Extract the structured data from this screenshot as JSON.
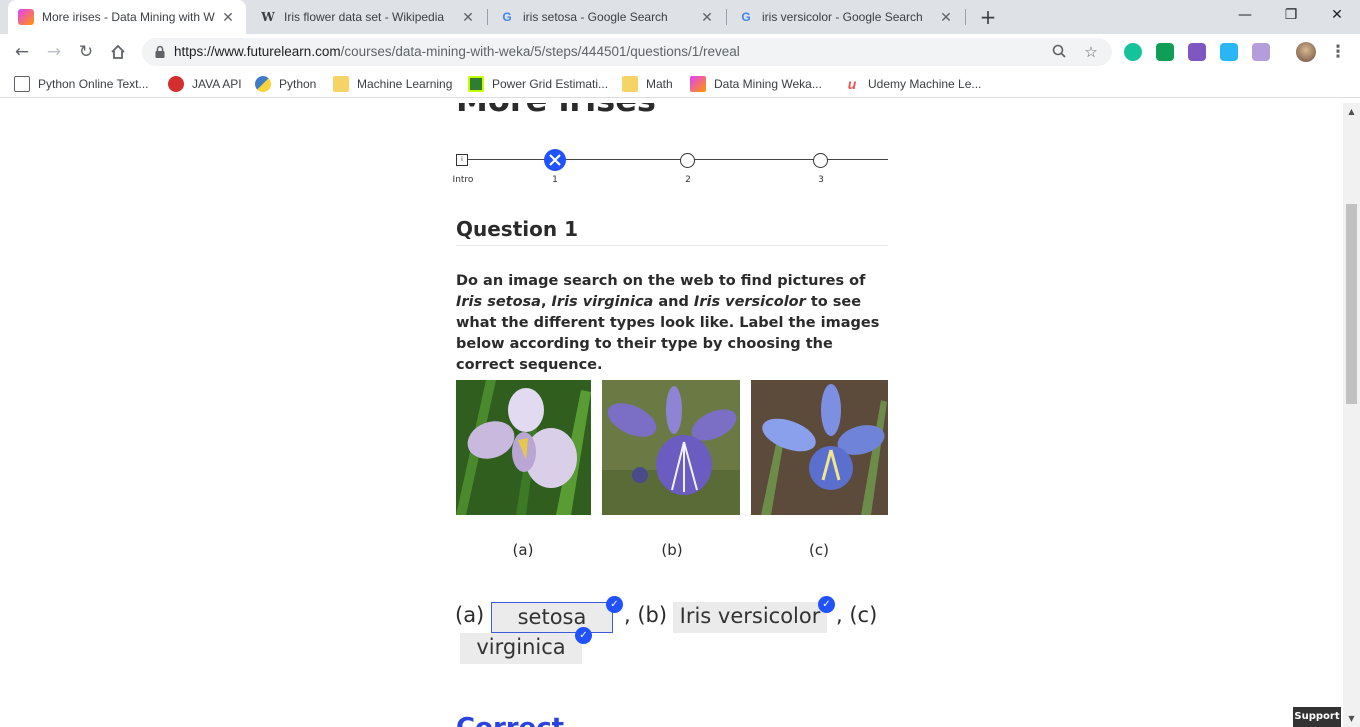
{
  "tabs": [
    {
      "title": "More irises - Data Mining with W",
      "favicon": "futurelearn-icon",
      "active": true
    },
    {
      "title": "Iris flower data set - Wikipedia",
      "favicon": "wikipedia-icon",
      "active": false
    },
    {
      "title": "iris setosa - Google Search",
      "favicon": "google-icon",
      "active": false
    },
    {
      "title": "iris versicolor - Google Search",
      "favicon": "google-icon",
      "active": false
    }
  ],
  "window_controls": {
    "minimize": "—",
    "restore": "❐",
    "close": "✕"
  },
  "address_bar": {
    "host": "https://www.futurelearn.com",
    "path": "/courses/data-mining-with-weka/5/steps/444501/questions/1/reveal"
  },
  "bookmarks": [
    {
      "label": "Python Online Text...",
      "color": "#5f6368"
    },
    {
      "label": "JAVA API",
      "color": "#d32f2f"
    },
    {
      "label": "Python",
      "color": "#3f7cc4"
    },
    {
      "label": "Machine Learning",
      "color": "#f6d365"
    },
    {
      "label": "Power Grid Estimati...",
      "color": "#2e7d32"
    },
    {
      "label": "Math",
      "color": "#f6d365"
    },
    {
      "label": "Data Mining Weka...",
      "color": "#e91e63"
    },
    {
      "label": "Udemy Machine Le...",
      "color": "#ec5252"
    }
  ],
  "page": {
    "title": "More irises",
    "stepper": {
      "steps": [
        {
          "label": "Intro",
          "state": "intro"
        },
        {
          "label": "1",
          "state": "incorrect-current"
        },
        {
          "label": "2",
          "state": "pending"
        },
        {
          "label": "3",
          "state": "pending"
        }
      ]
    },
    "question_title": "Question 1",
    "question_body": {
      "p1": "Do an image search on the web to find pictures of ",
      "setosa": "Iris setosa",
      "p2": ", ",
      "virginica": "Iris virginica",
      "p3": " and ",
      "versicolor": "Iris versicolor",
      "p4": " to see what the different types look like. Label the images below according to their type by choosing the correct sequence."
    },
    "images": [
      {
        "caption": "(a)",
        "subject": "iris-flower-pale"
      },
      {
        "caption": "(b)",
        "subject": "iris-flower-violet"
      },
      {
        "caption": "(c)",
        "subject": "iris-flower-blue"
      }
    ],
    "answer": {
      "a_label": "(a)",
      "a_value": "setosa",
      "b_label": ", (b)",
      "b_value": "Iris versicolor",
      "c_label": ", (c)",
      "c_value": "virginica"
    },
    "result_heading": "Correct",
    "support_button": "Support"
  },
  "colors": {
    "accent": "#2152ff",
    "correct": "#2b44e0"
  }
}
